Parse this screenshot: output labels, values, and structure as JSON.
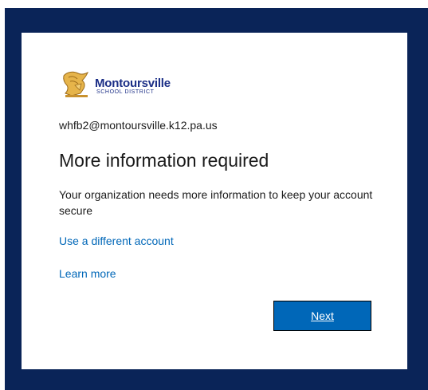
{
  "logo": {
    "name": "Montoursville",
    "subtitle": "SCHOOL DISTRICT",
    "icon": "warrior-head-icon"
  },
  "account": {
    "email": "whfb2@montoursville.k12.pa.us"
  },
  "main": {
    "title": "More information required",
    "description": "Your organization needs more information to keep your account secure"
  },
  "links": {
    "different_account": "Use a different account",
    "learn_more": "Learn more"
  },
  "buttons": {
    "next": "Next"
  },
  "colors": {
    "backdrop": "#0a2458",
    "link": "#0067b8",
    "button": "#0067b8",
    "logo_text": "#1b2e86"
  }
}
